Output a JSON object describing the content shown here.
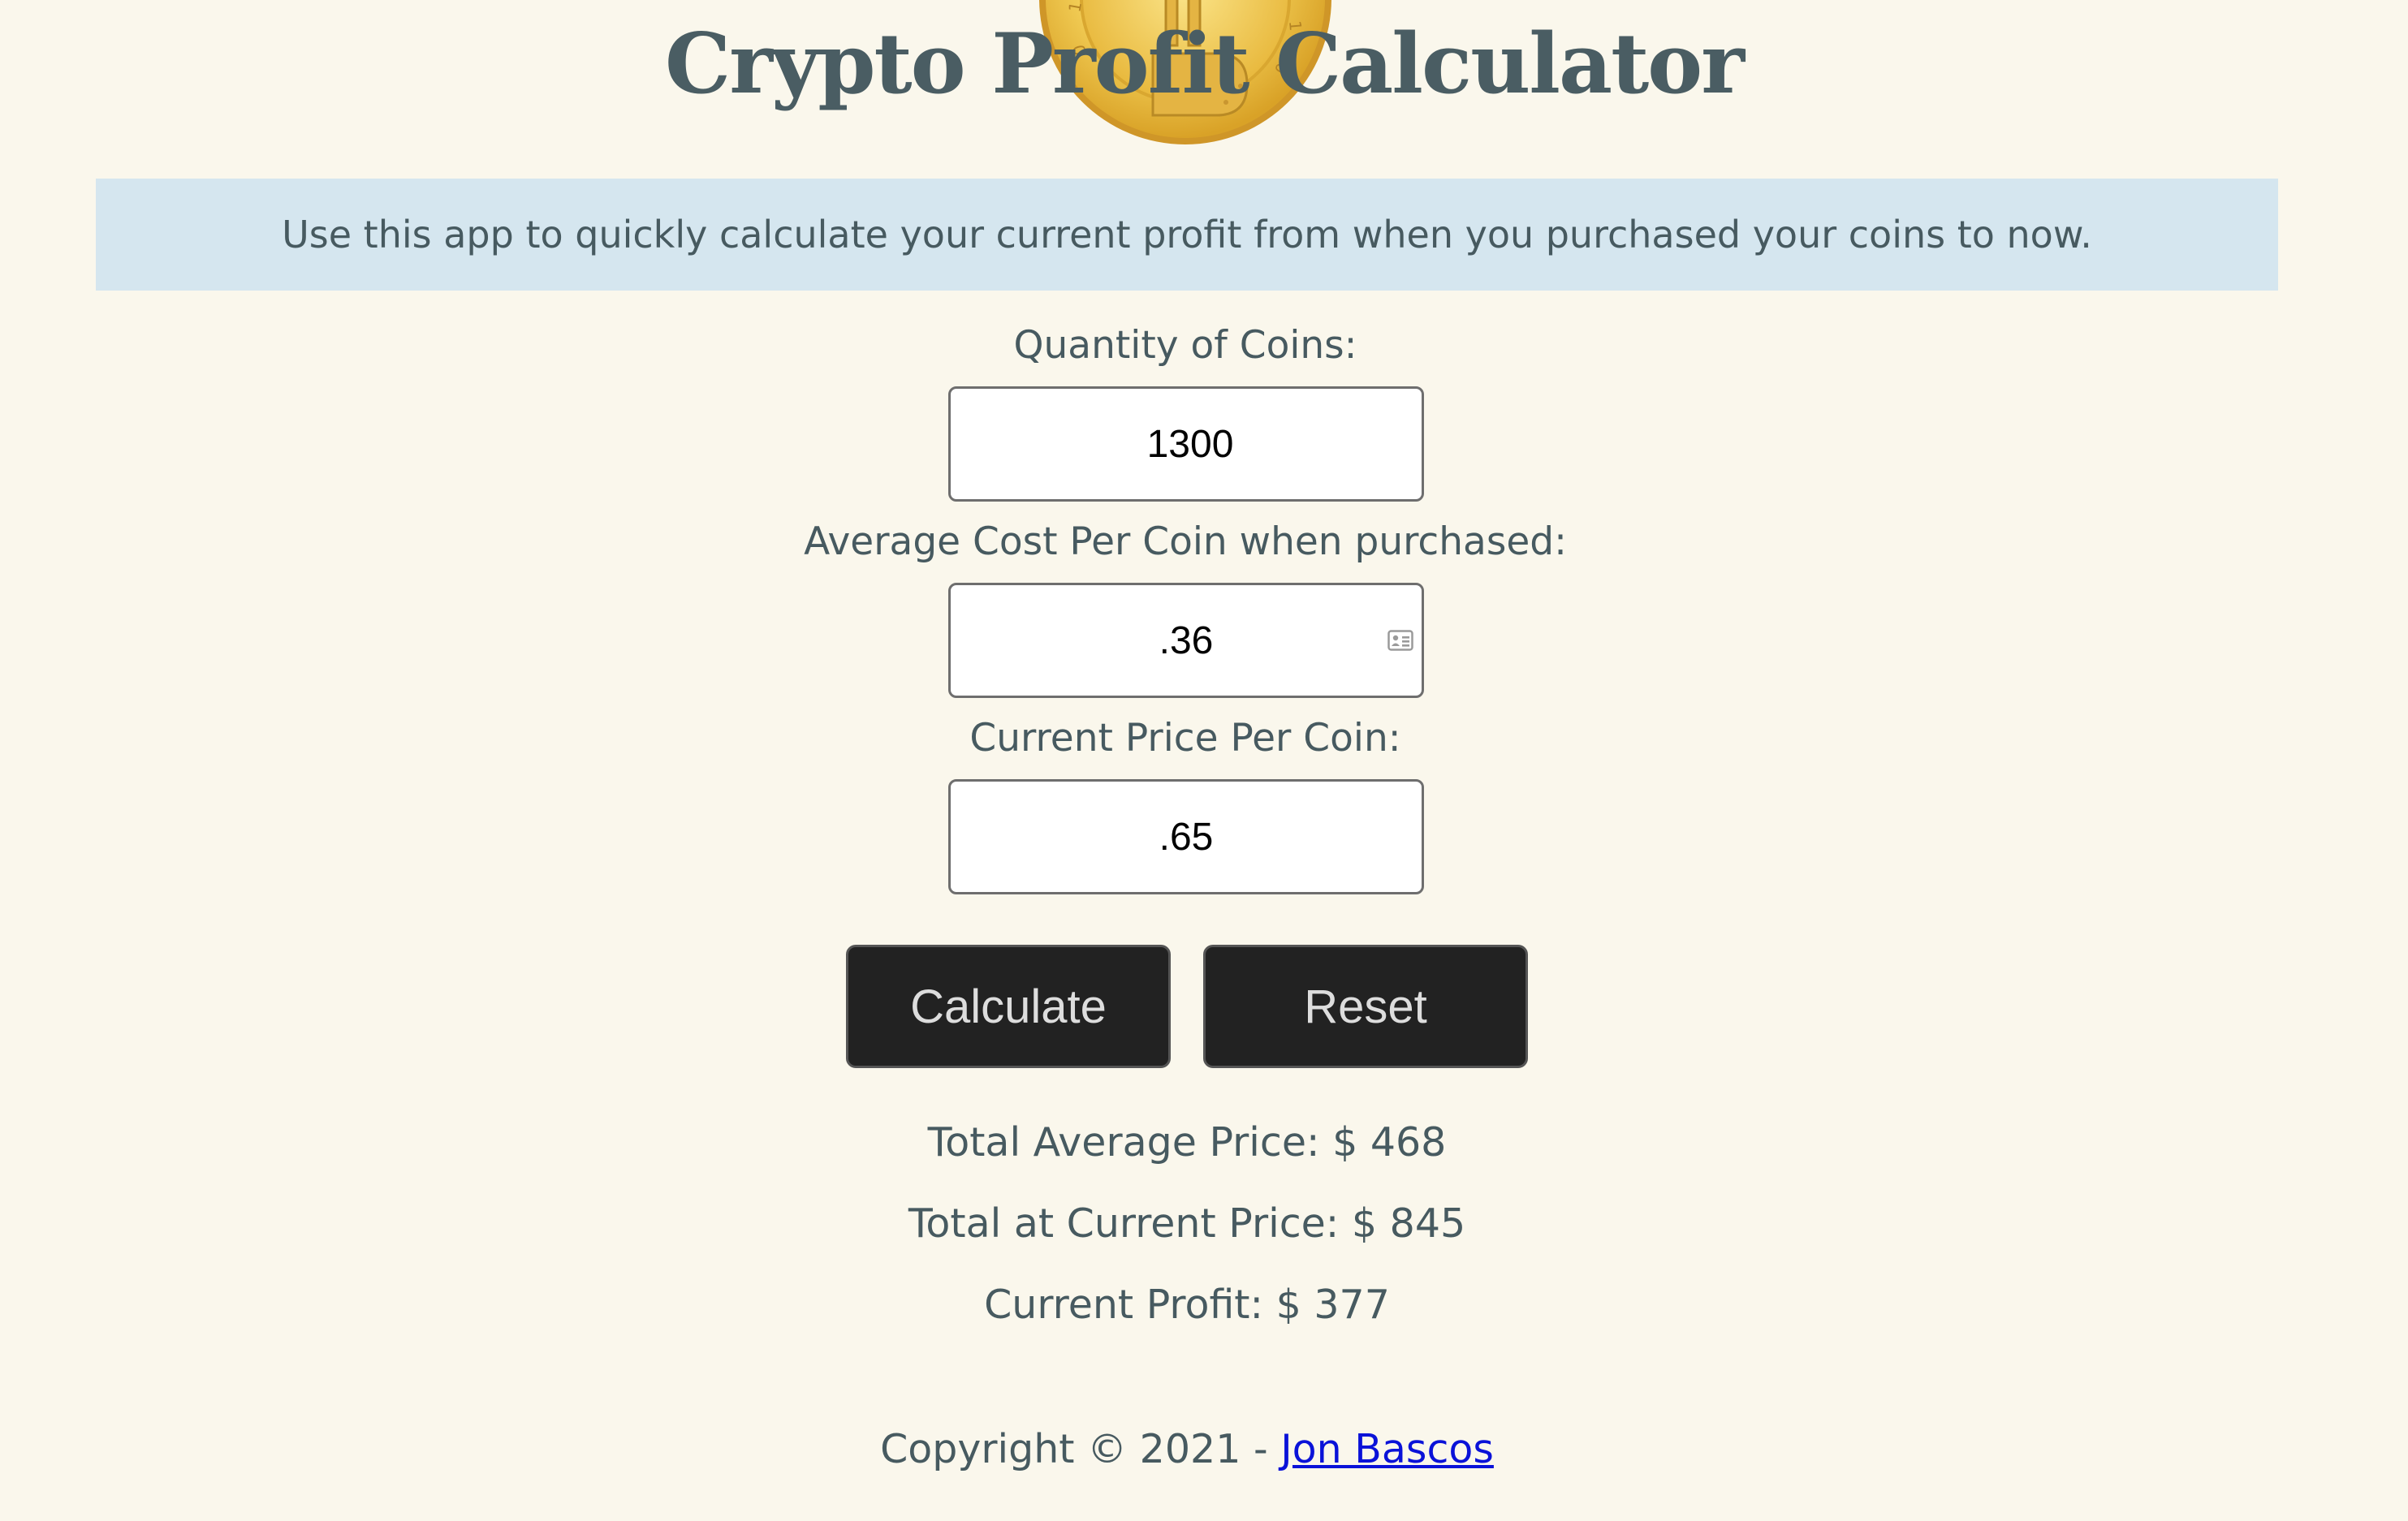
{
  "header": {
    "title": "Crypto Profit Calculator"
  },
  "banner": {
    "text": "Use this app to quickly calculate your current profit from when you purchased your coins to now."
  },
  "form": {
    "quantity_label": "Quantity of Coins:",
    "quantity_value": "1300",
    "avg_cost_label": "Average Cost Per Coin when purchased:",
    "avg_cost_value": ".36",
    "current_price_label": "Current Price Per Coin:",
    "current_price_value": ".65"
  },
  "buttons": {
    "calculate_label": "Calculate",
    "reset_label": "Reset"
  },
  "results": {
    "total_average": "Total Average Price: $ 468",
    "total_current": "Total at Current Price: $ 845",
    "current_profit": "Current Profit: $ 377"
  },
  "footer": {
    "copyright": "Copyright © 2021 -",
    "author_link": "Jon Bascos"
  },
  "colors": {
    "background": "#faf7ec",
    "banner": "#d5e6ef",
    "text": "#475a60",
    "button": "#222222",
    "link": "#0a12d8"
  },
  "icons": {
    "logo": "bitcoin-coin-icon",
    "autofill": "contact-card-icon"
  }
}
